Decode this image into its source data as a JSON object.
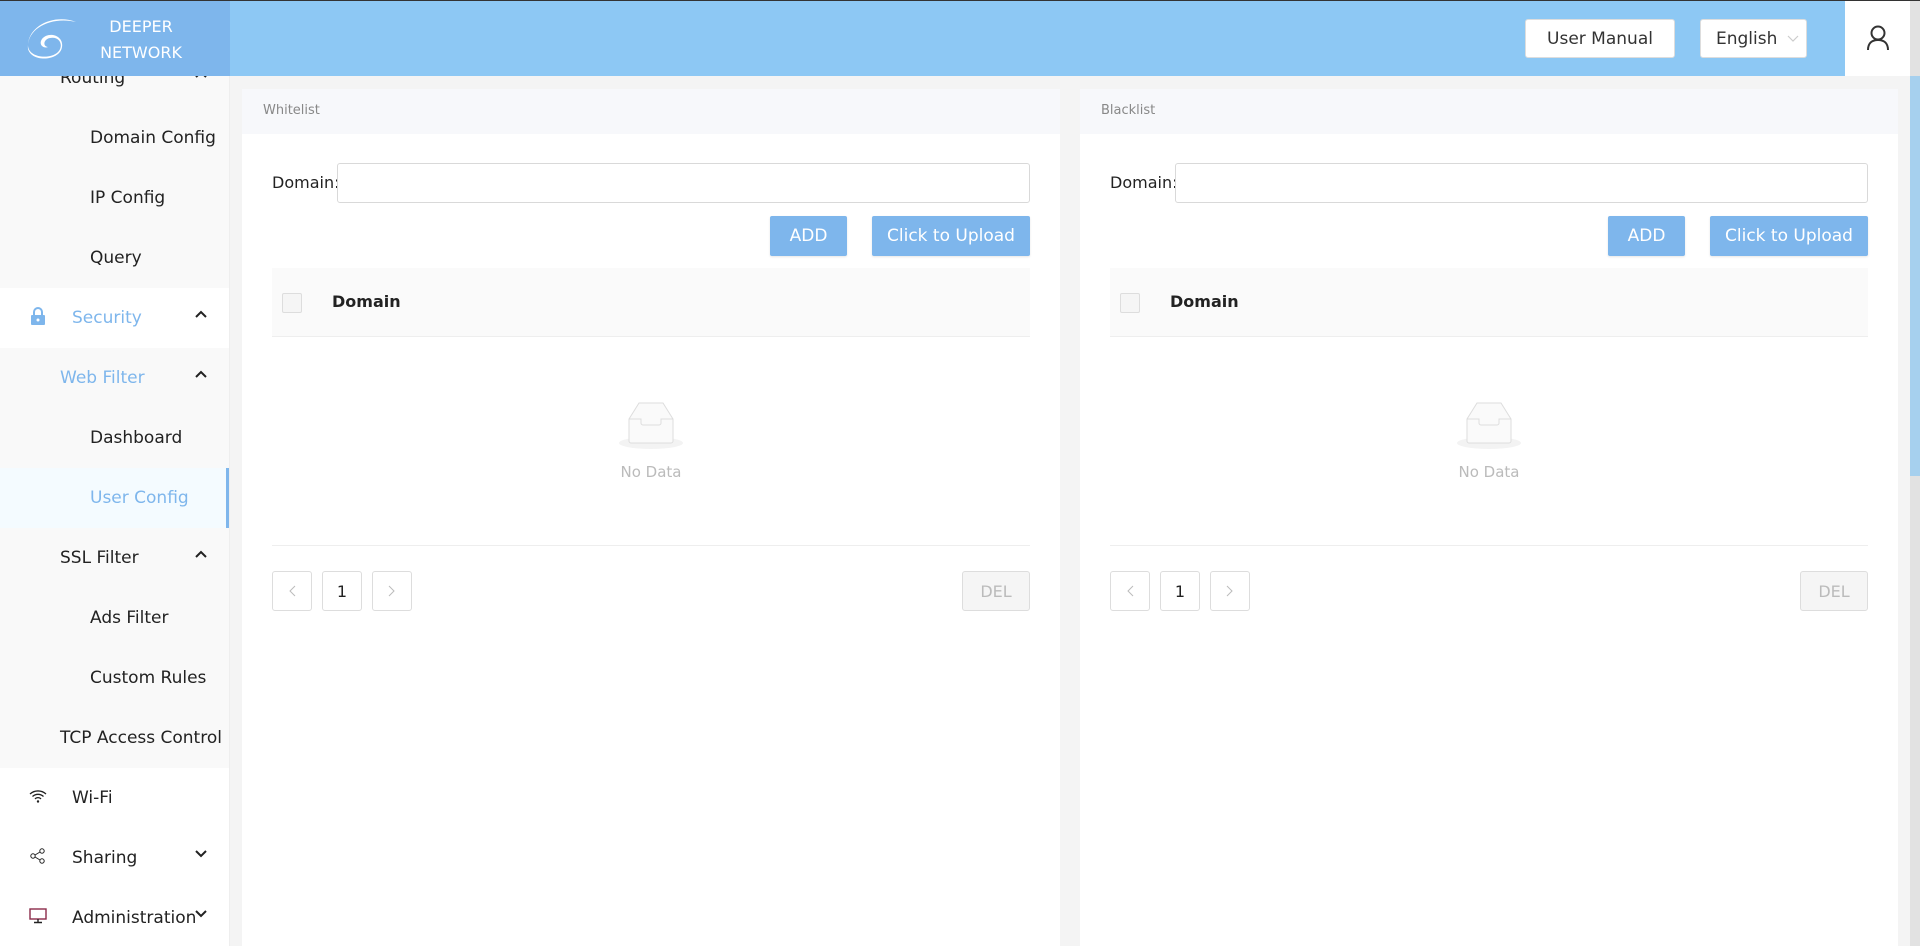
{
  "header": {
    "logo_line1": "DEEPER",
    "logo_line2": "NETWORK",
    "user_manual": "User Manual",
    "language": "English",
    "avatar_icon": "user-icon"
  },
  "colors": {
    "accent": "#7eb6ec",
    "header": "#8dc8f4"
  },
  "sidebar": {
    "items": [
      {
        "label": "Routing",
        "level": 1,
        "chevron": "up"
      },
      {
        "label": "Domain Config",
        "level": 2
      },
      {
        "label": "IP Config",
        "level": 2
      },
      {
        "label": "Query",
        "level": 2
      },
      {
        "label": "Security",
        "level": 0,
        "icon": "lock-icon",
        "chevron": "up",
        "active": true
      },
      {
        "label": "Web Filter",
        "level": 1,
        "chevron": "up",
        "active": true
      },
      {
        "label": "Dashboard",
        "level": 2
      },
      {
        "label": "User Config",
        "level": 2,
        "selected": true
      },
      {
        "label": "SSL Filter",
        "level": 1,
        "chevron": "up"
      },
      {
        "label": "Ads Filter",
        "level": 2
      },
      {
        "label": "Custom Rules",
        "level": 2
      },
      {
        "label": "TCP Access Control",
        "level": 1
      },
      {
        "label": "Wi-Fi",
        "level": 0,
        "icon": "wifi-icon"
      },
      {
        "label": "Sharing",
        "level": 0,
        "icon": "share-icon",
        "chevron": "down"
      },
      {
        "label": "Administration",
        "level": 0,
        "icon": "monitor-icon",
        "chevron": "down"
      }
    ]
  },
  "panels": [
    {
      "title": "Whitelist",
      "domain_label": "Domain:",
      "domain_value": "",
      "add": "ADD",
      "upload": "Click to Upload",
      "column": "Domain",
      "empty": "No Data",
      "page": "1",
      "del": "DEL"
    },
    {
      "title": "Blacklist",
      "domain_label": "Domain:",
      "domain_value": "",
      "add": "ADD",
      "upload": "Click to Upload",
      "column": "Domain",
      "empty": "No Data",
      "page": "1",
      "del": "DEL"
    }
  ]
}
